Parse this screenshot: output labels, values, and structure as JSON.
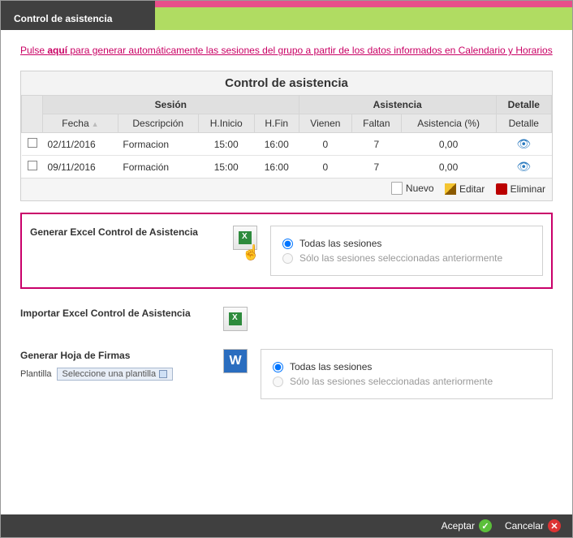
{
  "header": {
    "title": "Control de asistencia"
  },
  "link": {
    "prefix": "Pulse ",
    "bold": "aquí",
    "suffix": " para generar automáticamente las sesiones del grupo a partir de los datos informados en Calendario y Horarios"
  },
  "table": {
    "title": "Control de asistencia",
    "groups": {
      "sesion": "Sesión",
      "asistencia": "Asistencia",
      "detalle": "Detalle"
    },
    "cols": {
      "fecha": "Fecha",
      "descripcion": "Descripción",
      "hinicio": "H.Inicio",
      "hfin": "H.Fin",
      "vienen": "Vienen",
      "faltan": "Faltan",
      "asistencia_pct": "Asistencia (%)",
      "detalle": "Detalle"
    },
    "rows": [
      {
        "fecha": "02/11/2016",
        "descripcion": "Formacion",
        "hinicio": "15:00",
        "hfin": "16:00",
        "vienen": "0",
        "faltan": "7",
        "pct": "0,00"
      },
      {
        "fecha": "09/11/2016",
        "descripcion": "Formación",
        "hinicio": "15:00",
        "hfin": "16:00",
        "vienen": "0",
        "faltan": "7",
        "pct": "0,00"
      }
    ],
    "toolbar": {
      "nuevo": "Nuevo",
      "editar": "Editar",
      "eliminar": "Eliminar"
    }
  },
  "genExcel": {
    "label": "Generar Excel Control de Asistencia",
    "opt_all": "Todas las sesiones",
    "opt_sel": "Sólo las sesiones seleccionadas anteriormente"
  },
  "impExcel": {
    "label": "Importar Excel Control de Asistencia"
  },
  "firmas": {
    "label": "Generar Hoja de Firmas",
    "plantilla_label": "Plantilla",
    "plantilla_placeholder": "Seleccione una plantilla",
    "opt_all": "Todas las sesiones",
    "opt_sel": "Sólo las sesiones seleccionadas anteriormente"
  },
  "footer": {
    "aceptar": "Aceptar",
    "cancelar": "Cancelar"
  }
}
